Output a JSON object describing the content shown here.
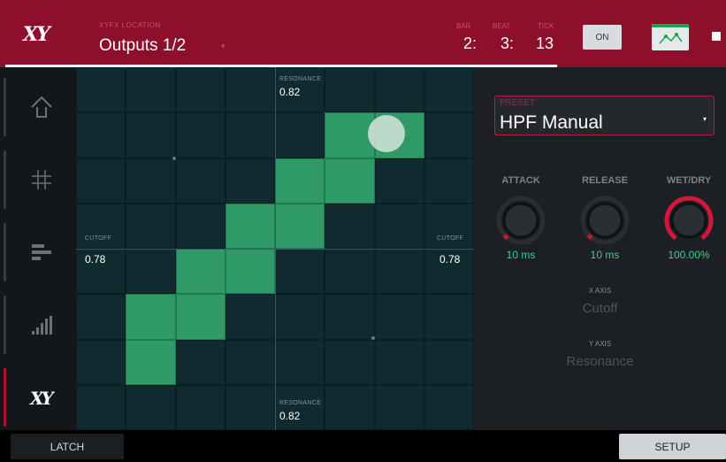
{
  "header": {
    "logo_text": "XY",
    "location_label": "XYFX LOCATION",
    "location_value": "Outputs 1/2",
    "location_caret": "▾",
    "bar_label": "BAR",
    "bar_value": "2:",
    "beat_label": "BEAT",
    "beat_value": "3:",
    "tick_label": "TICK",
    "tick_value": "13",
    "on_label": "ON"
  },
  "sidebar": {
    "items": [
      {
        "icon": "arrow-up-icon"
      },
      {
        "icon": "grid-hash-icon"
      },
      {
        "icon": "bars-align-icon"
      },
      {
        "icon": "level-bars-icon"
      },
      {
        "icon": "xy-logo-icon",
        "active": true
      }
    ]
  },
  "grid": {
    "top_label": "RESONANCE",
    "top_value": "0.82",
    "bottom_label": "RESONANCE",
    "bottom_value": "0.82",
    "left_label": "CUTOFF",
    "left_value": "0.78",
    "right_label": "CUTOFF",
    "right_value": "0.78",
    "trail_cells_col_row": [
      [
        5,
        1
      ],
      [
        6,
        1
      ],
      [
        4,
        2
      ],
      [
        5,
        2
      ],
      [
        3,
        3
      ],
      [
        4,
        3
      ],
      [
        2,
        4
      ],
      [
        3,
        4
      ],
      [
        1,
        5
      ],
      [
        2,
        5
      ],
      [
        1,
        6
      ]
    ]
  },
  "panel": {
    "preset_label": "PRESET",
    "preset_value": "HPF Manual",
    "preset_caret": "▾",
    "knobs": [
      {
        "label": "ATTACK",
        "value": "10 ms"
      },
      {
        "label": "RELEASE",
        "value": "10 ms"
      },
      {
        "label": "WET/DRY",
        "value": "100.00%"
      }
    ],
    "x_axis_label": "X AXIS",
    "x_axis_value": "Cutoff",
    "y_axis_label": "Y AXIS",
    "y_axis_value": "Resonance"
  },
  "footer": {
    "latch_label": "LATCH",
    "setup_label": "SETUP"
  },
  "colors": {
    "header_bg": "#8e0f2c",
    "accent_red": "#c01838",
    "grid_bg": "#0f2b30",
    "trail_green": "#2f9a67",
    "value_green": "#3bd08a"
  }
}
